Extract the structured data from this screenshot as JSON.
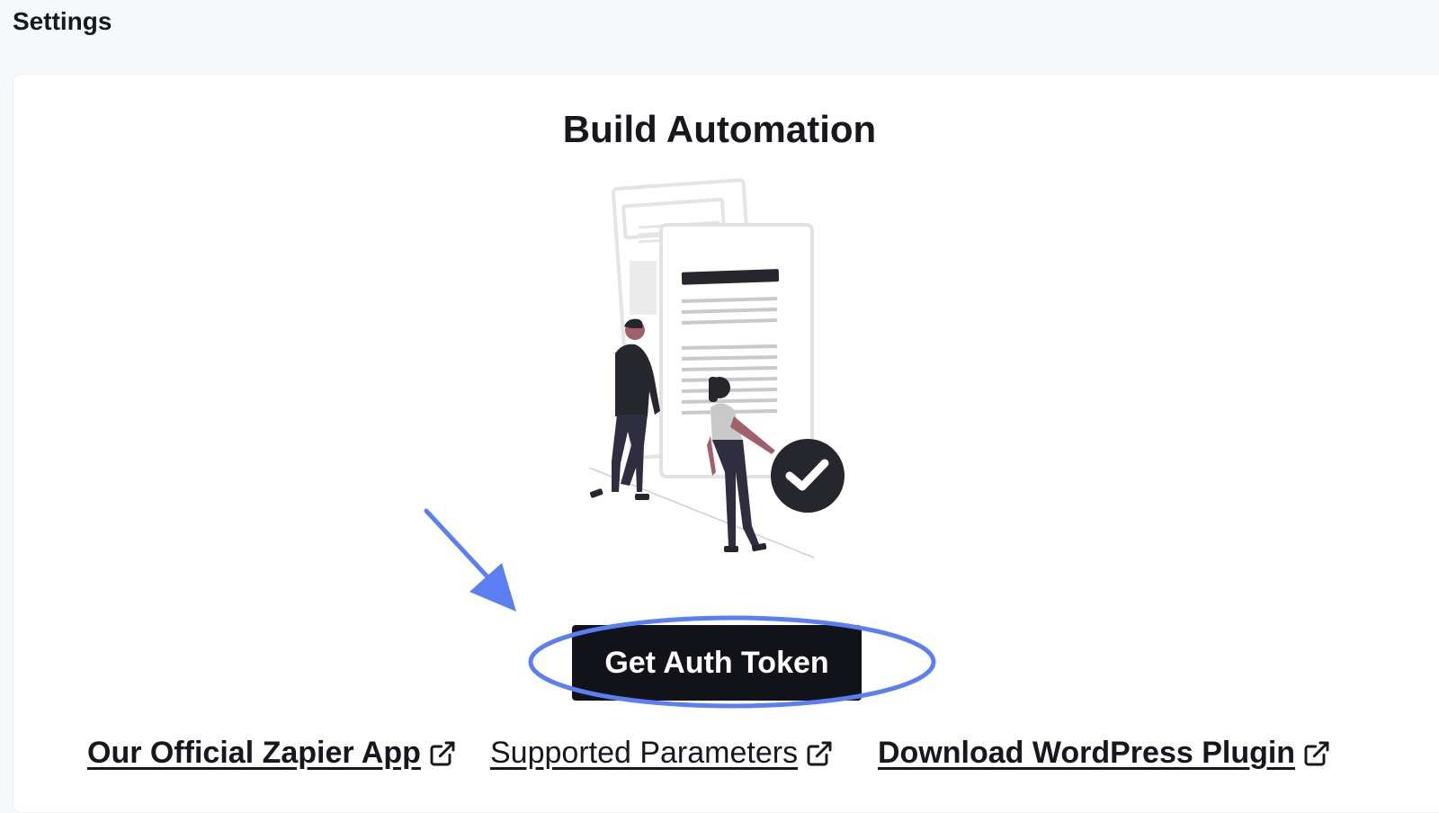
{
  "header": {
    "title": "Settings"
  },
  "card": {
    "title": "Build Automation"
  },
  "actions": {
    "get_token_label": "Get Auth Token"
  },
  "links": [
    {
      "label": "Our Official Zapier App ",
      "icon": "external-link-icon"
    },
    {
      "label": "Supported Parameters ",
      "icon": "external-link-icon"
    },
    {
      "label": "Download WordPress Plugin ",
      "icon": "external-link-icon"
    }
  ],
  "colors": {
    "button_bg": "#111319",
    "annotation": "#5b7ef2",
    "text": "#16181d"
  }
}
